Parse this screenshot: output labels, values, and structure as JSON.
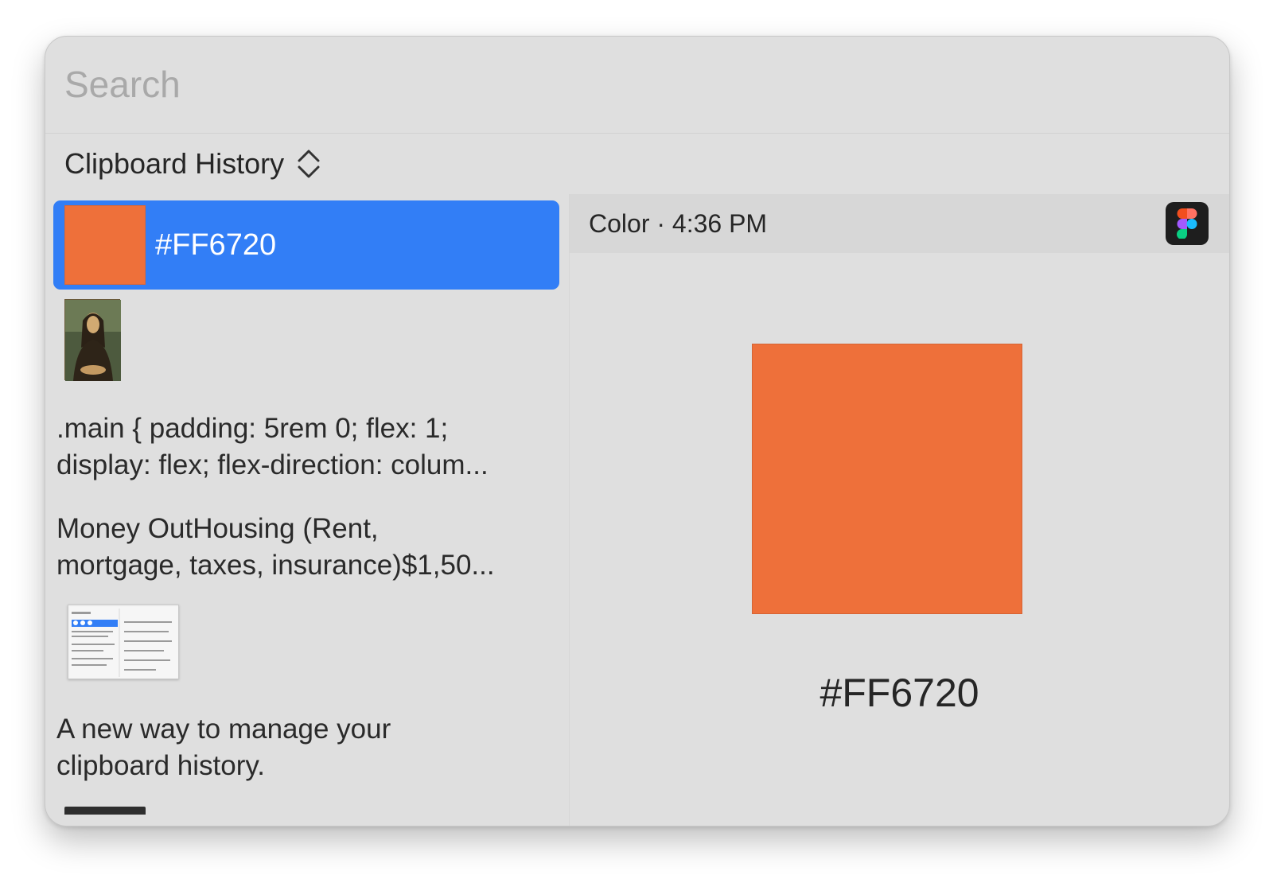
{
  "search": {
    "placeholder": "Search",
    "value": ""
  },
  "source": {
    "label": "Clipboard History",
    "icon": "chevron-updown-icon"
  },
  "history": {
    "selected_color": {
      "hex": "#FF6720",
      "swatch": "#EE703A"
    },
    "image_item": {
      "kind": "image",
      "icon": "painting-thumbnail"
    },
    "code_item": ".main {  padding: 5rem 0;  flex: 1;\ndisplay: flex;  flex-direction: colum...",
    "money_item": "Money OutHousing (Rent,\nmortgage, taxes, insurance)$1,50...",
    "screenshot_item": {
      "kind": "image",
      "icon": "screenshot-thumbnail"
    },
    "tagline_item": "A new way to manage your\nclipboard history."
  },
  "preview": {
    "meta": "Color · 4:36 PM",
    "app_icon": "figma-icon",
    "swatch": "#EE703A",
    "value": "#FF6720"
  },
  "colors": {
    "selection": "#327EF6",
    "window_bg": "#DFDFDF",
    "header_bg": "#D7D7D7"
  }
}
